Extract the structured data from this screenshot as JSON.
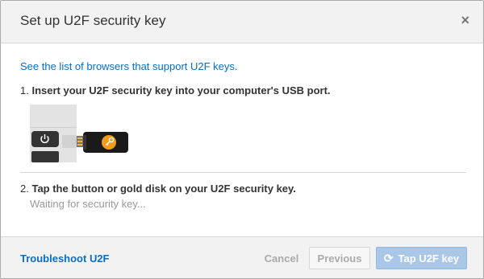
{
  "dialog": {
    "title": "Set up U2F security key",
    "close_glyph": "×"
  },
  "body": {
    "browsers_link": "See the list of browsers that support U2F keys.",
    "step1": {
      "number": "1.",
      "text": "Insert your U2F security key into your computer's USB port."
    },
    "illustration_icon": "usb-security-key-illustration",
    "step2": {
      "number": "2.",
      "text": "Tap the button or gold disk on your U2F security key.",
      "status": "Waiting for security key..."
    }
  },
  "footer": {
    "troubleshoot_link": "Troubleshoot U2F",
    "cancel_label": "Cancel",
    "previous_label": "Previous",
    "tap_label": "Tap U2F key",
    "tap_icon": "refresh-icon",
    "tap_icon_glyph": "⟳"
  },
  "colors": {
    "link": "#0a6ebd",
    "primary_disabled": "#a9c8e8",
    "header_bg": "#f2f2f2",
    "key_gold": "#f29b1d"
  }
}
